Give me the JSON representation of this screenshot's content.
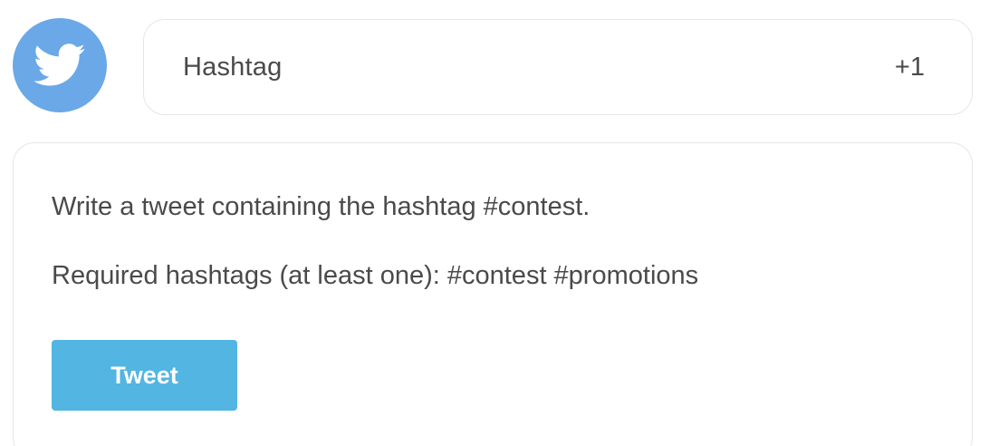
{
  "avatar": {
    "icon": "twitter-bird-icon",
    "background_color": "#6aa8e8"
  },
  "header": {
    "title": "Hashtag",
    "points": "+1"
  },
  "task": {
    "instruction": "Write a tweet containing the hashtag #contest.",
    "required_hashtags": "Required hashtags (at least one): #contest #promotions"
  },
  "actions": {
    "tweet_label": "Tweet",
    "tweet_color": "#52b5e2"
  }
}
